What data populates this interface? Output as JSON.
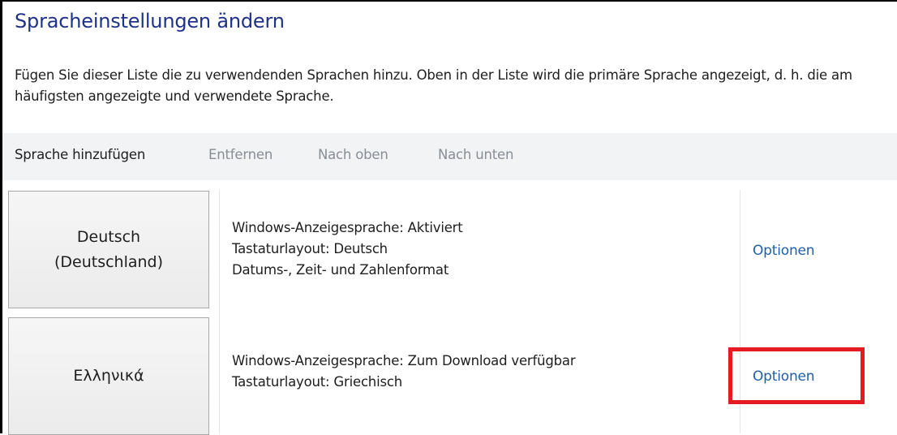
{
  "page": {
    "title": "Spracheinstellungen ändern",
    "description": "Fügen Sie dieser Liste die zu verwendenden Sprachen hinzu. Oben in der Liste wird die primäre Sprache angezeigt, d. h. die am häufigsten angezeigte und verwendete Sprache."
  },
  "toolbar": {
    "add_label": "Sprache hinzufügen",
    "remove_label": "Entfernen",
    "up_label": "Nach oben",
    "down_label": "Nach unten"
  },
  "languages": [
    {
      "name_line1": "Deutsch",
      "name_line2": "(Deutschland)",
      "details": [
        "Windows-Anzeigesprache: Aktiviert",
        "Tastaturlayout: Deutsch",
        "Datums-, Zeit- und Zahlenformat"
      ],
      "options_label": "Optionen"
    },
    {
      "name_line1": "Ελληνικά",
      "details": [
        "Windows-Anzeigesprache: Zum Download verfügbar",
        "Tastaturlayout: Griechisch"
      ],
      "options_label": "Optionen"
    }
  ],
  "colors": {
    "title": "#1e3287",
    "link": "#1f5fa8",
    "toolbar_bg": "#f1f3f5",
    "disabled_text": "#888e94",
    "highlight": "#e51b23"
  }
}
